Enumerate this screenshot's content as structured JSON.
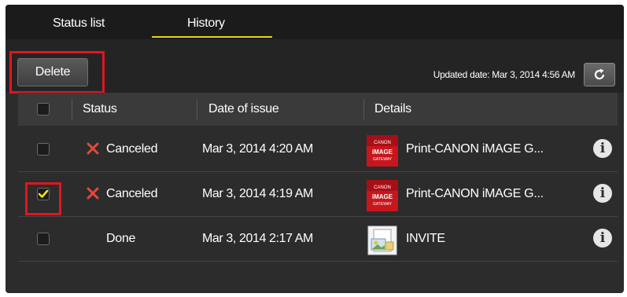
{
  "tabs": [
    {
      "label": "Status list",
      "active": false
    },
    {
      "label": "History",
      "active": true
    }
  ],
  "toolbar": {
    "delete_label": "Delete",
    "updated_text": "Updated date: Mar 3, 2014 4:56 AM",
    "refresh_icon": "refresh-icon"
  },
  "table": {
    "headers": {
      "status": "Status",
      "date": "Date of issue",
      "details": "Details"
    },
    "rows": [
      {
        "checked": false,
        "status": "Canceled",
        "status_icon": "x-icon",
        "date": "Mar 3, 2014 4:20 AM",
        "details": "Print-CANON iMAGE G...",
        "thumb": "canon-image-gateway-icon"
      },
      {
        "checked": true,
        "status": "Canceled",
        "status_icon": "x-icon",
        "date": "Mar 3, 2014 4:19 AM",
        "details": "Print-CANON iMAGE G...",
        "thumb": "canon-image-gateway-icon"
      },
      {
        "checked": false,
        "status": "Done",
        "status_icon": "",
        "date": "Mar 3, 2014 2:17 AM",
        "details": "INVITE",
        "thumb": "document-image-icon"
      }
    ]
  },
  "thumb_labels": {
    "canon_top": "CANON",
    "canon_mid": "iMAGE",
    "canon_bottom": "GATEWAY"
  },
  "colors": {
    "accent_underline": "#e6d21a",
    "highlight_red": "#e0161e",
    "cancel_x": "#e8473b",
    "checkmark": "#f2e21b",
    "canon_red": "#c8161d"
  }
}
